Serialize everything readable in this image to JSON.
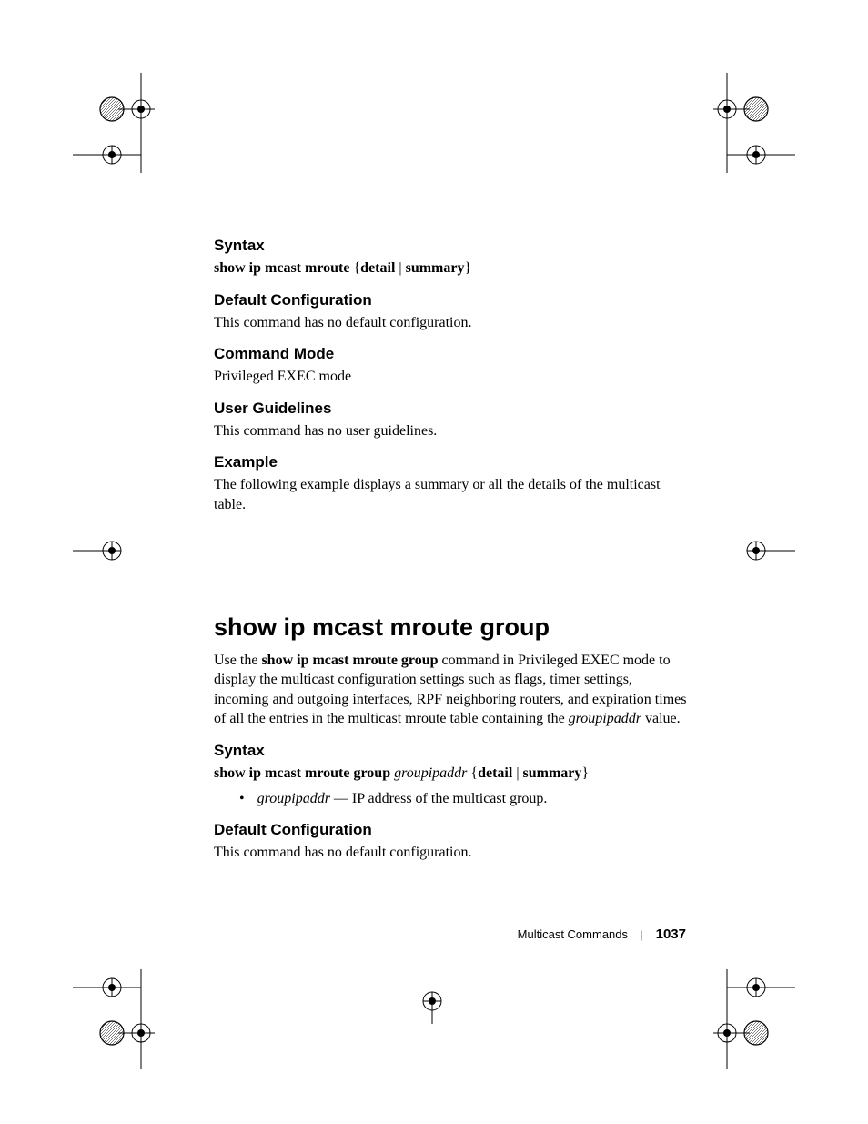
{
  "section1": {
    "syntax": {
      "heading": "Syntax",
      "cmd_bold": "show ip mcast mroute",
      "cmd_rest": " {",
      "opt1": "detail",
      "sep": " | ",
      "opt2": "summary",
      "close": "}"
    },
    "default_config": {
      "heading": "Default Configuration",
      "text": "This command has no default configuration."
    },
    "command_mode": {
      "heading": "Command Mode",
      "text": "Privileged EXEC mode"
    },
    "user_guidelines": {
      "heading": "User Guidelines",
      "text": "This command has no user guidelines."
    },
    "example": {
      "heading": "Example",
      "text": "The following example displays a summary or all the details of the multicast table."
    }
  },
  "section2": {
    "title": "show ip mcast mroute group",
    "intro": {
      "pre": "Use the ",
      "bold": "show ip mcast mroute group",
      "post1": " command in Privileged EXEC mode to display the multicast configuration settings such as flags, timer settings, incoming and outgoing interfaces, RPF neighboring routers, and expiration times of all the entries in the multicast mroute table containing the ",
      "italic": "groupipaddr",
      "post2": " value."
    },
    "syntax": {
      "heading": "Syntax",
      "cmd_bold": "show ip mcast mroute group",
      "arg_italic": " groupipaddr",
      "rest": " {",
      "opt1": "detail",
      "sep": " | ",
      "opt2": "summary",
      "close": "}"
    },
    "bullet": {
      "arg": "groupipaddr",
      "desc": " — IP address of the multicast group."
    },
    "default_config": {
      "heading": "Default Configuration",
      "text": "This command has no default configuration."
    }
  },
  "footer": {
    "title": "Multicast Commands",
    "page": "1037"
  }
}
